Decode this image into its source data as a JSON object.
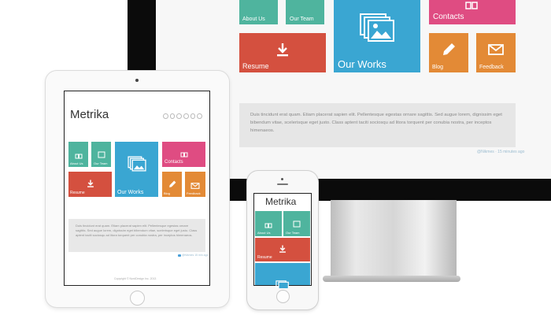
{
  "desktop": {
    "tiles": {
      "about": "About Us",
      "team": "Our Team",
      "works": "Our Works",
      "contacts": "Contacts",
      "resume": "Resume",
      "blog": "Blog",
      "feedback": "Feedback"
    },
    "quote": "Duis tincidunt erat quam. Etiam placerat sapien elit. Pellentesque egestas ornare sagittis. Sed augue lorem, dignissim eget bibendum vitae, scelerisque eget justo. Class aptent taciti sociosqu ad litora torquent per conubia nostra, per inceptos himenaeos.",
    "tweet_meta": "@Nikmes · 15 minutes ago"
  },
  "tablet": {
    "brand": "Metrika",
    "tiles": {
      "about": "About Us",
      "team": "Our Team",
      "works": "Our Works",
      "contacts": "Contacts",
      "resume": "Resume",
      "blog": "Blog",
      "feedback": "Feedback"
    },
    "quote": "Duis tincidunt erat quam. Etiam placerat sapien elit. Pellentesque egestas ornare sagittis. Sed augue lorem, dignissim eget bibendum vitae, scelerisque eget justo. Class aptent taciti sociosqu ad litora torquent per conubia nostra, per inceptos himenaeos.",
    "tweet_meta": "@Nikmes 15 min ago",
    "footer": "Copyright © NordDesign Inc. 2013"
  },
  "phone": {
    "brand": "Metrika",
    "tiles": {
      "about": "About Us",
      "team": "Our Team",
      "resume": "Resume"
    }
  },
  "colors": {
    "teal": "#4fb49e",
    "blue": "#3aa6d2",
    "pink": "#df4c82",
    "red": "#d4503f",
    "orange": "#e38a36"
  }
}
